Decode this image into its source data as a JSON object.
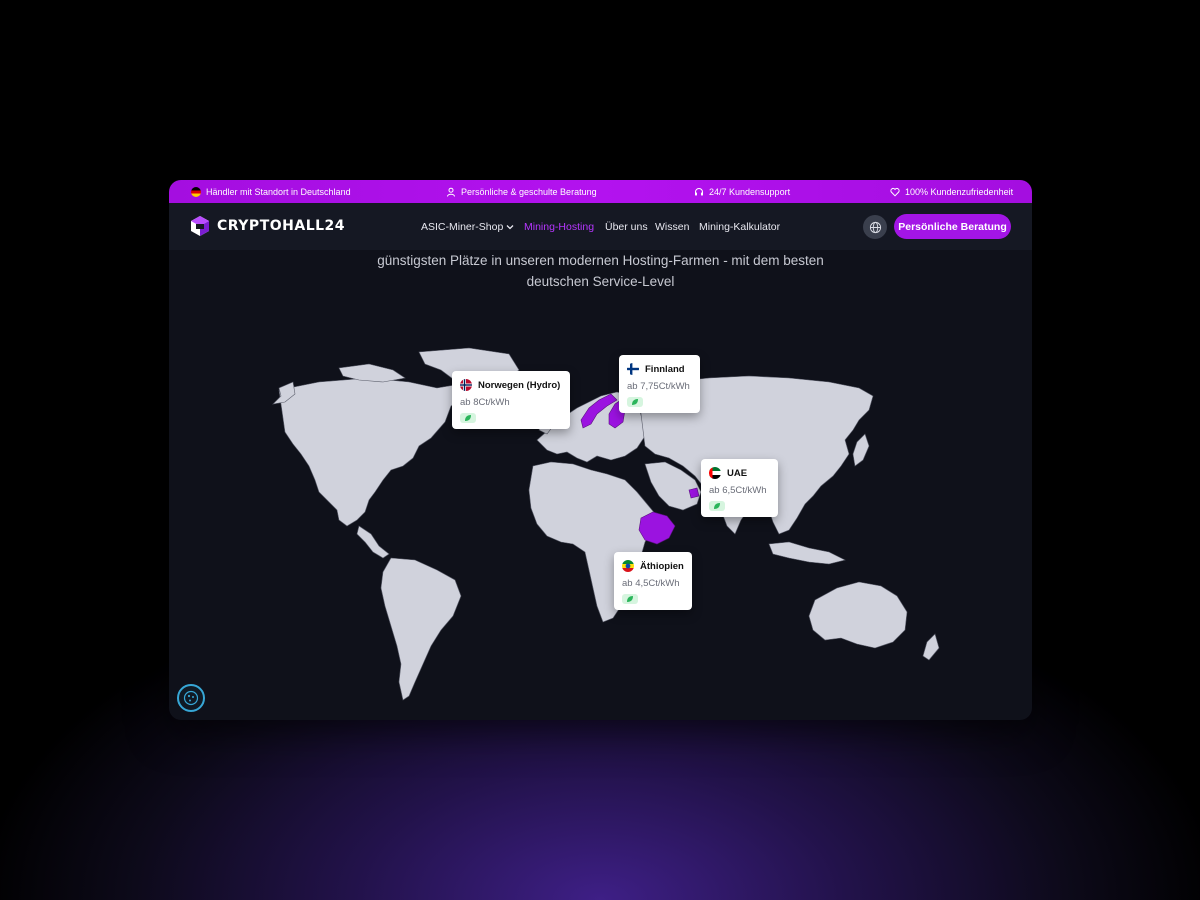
{
  "topbar": {
    "items": [
      {
        "label": "Händler mit Standort in Deutschland",
        "icon": "german-flag-icon"
      },
      {
        "label": "Persönliche & geschulte Beratung",
        "icon": "user-icon"
      },
      {
        "label": "24/7 Kundensupport",
        "icon": "headset-icon"
      },
      {
        "label": "100% Kundenzufriedenheit",
        "icon": "heart-icon"
      }
    ]
  },
  "brand": {
    "name": "CRYPTOHALL24"
  },
  "nav": {
    "items": [
      {
        "label": "ASIC-Miner-Shop",
        "has_dropdown": true
      },
      {
        "label": "Mining-Hosting",
        "active": true
      },
      {
        "label": "Über uns"
      },
      {
        "label": "Wissen"
      },
      {
        "label": "Mining-Kalkulator"
      }
    ],
    "language_icon": "globe-icon",
    "cta_label": "Persönliche Beratung"
  },
  "hero": {
    "subtitle_line1": "günstigsten Plätze in unseren modernen Hosting-Farmen - mit dem besten",
    "subtitle_line2": "deutschen Service-Level"
  },
  "map": {
    "land_color": "#d0d2dc",
    "highlight_color": "#9b13e0",
    "locations": [
      {
        "name": "Norwegen (Hydro)",
        "price": "ab 8Ct/kWh",
        "flag": "norway-flag-icon"
      },
      {
        "name": "Finnland",
        "price": "ab 7,75Ct/kWh",
        "flag": "finland-flag-icon"
      },
      {
        "name": "UAE",
        "price": "ab 6,5Ct/kWh",
        "flag": "uae-flag-icon"
      },
      {
        "name": "Äthiopien",
        "price": "ab 4,5Ct/kWh",
        "flag": "ethiopia-flag-icon"
      }
    ]
  },
  "colors": {
    "accent": "#a315e6",
    "background": "#0f111a",
    "nav": "#151823"
  }
}
